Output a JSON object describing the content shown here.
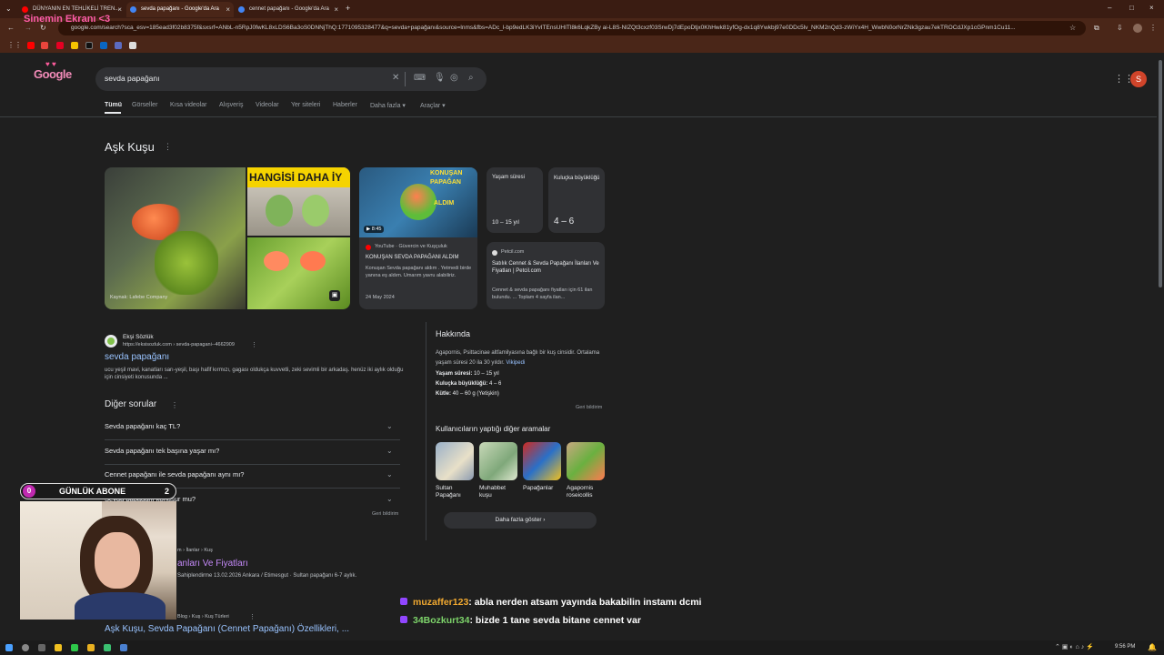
{
  "browser": {
    "tabs": [
      {
        "title": "DÜNYANIN EN TEHLİKELİ TREN...",
        "active": false
      },
      {
        "title": "sevda papağanı - Google'da Ara",
        "active": true
      },
      {
        "title": "cennet papağanı - Google'da Ara",
        "active": false
      }
    ],
    "new_tab_icon": "+",
    "url": "google.com/search?sca_esv=185ead3f02b8375f&sxsrf=ANbL-n5RpJ0fwKL8xLDS6Ba3oS0DNNjThQ:1771095328477&q=sevda+papağanı&source=lnms&fbs=ADc_l-bp9edLK3iYvITEnsUHITl8k6LqkZBy ai-L8S-NIZQt3cxzf03SrwDj7dEpoDtjx0KhHwk81yfOg-dx1q8Ywkbj97e0DDc5lv_NKM2nQd3-zWiYx4H_WwbN0orNrZNk3gzau7ekTROCdJXp1cGPnm1Cu11..."
  },
  "overlay": {
    "stream_title": "Sinemin Ekranı <3",
    "sub_counter_left": "0",
    "sub_counter_label": "GÜNLÜK ABONE",
    "sub_counter_right": "2",
    "chat": [
      {
        "user": "muzaffer123",
        "message": ": abla nerden atsam yayında bakabilin instamı dcmi",
        "color": "#f0a830"
      },
      {
        "user": "34Bozkurt34",
        "message": ": bizde 1 tane sevda bitane cennet var",
        "color": "#7dd36a"
      }
    ]
  },
  "google": {
    "logo": "Google",
    "query": "sevda papağanı",
    "nav_tabs": [
      "Tümü",
      "Görseller",
      "Kısa videolar",
      "Alışveriş",
      "Videolar",
      "Yer siteleri",
      "Haberler",
      "Daha fazla",
      "Araçlar"
    ],
    "avatar_letter": "S"
  },
  "knowledge": {
    "title": "Aşk Kuşu",
    "image_source": "Kaynak: Lafebe Company",
    "image_overlay_text": "HANGİSİ DAHA İY",
    "video": {
      "thumb_text_1": "KONUŞAN",
      "thumb_text_2": "PAPAĞAN",
      "thumb_text_3": "ALDIM",
      "duration": "▶ 8:45",
      "source": "YouTube · Güvercin ve Kuşçuluk",
      "title": "KONUŞAN SEVDA PAPAĞANI ALDIM",
      "snippet": "Konuşan Sevda papağanı aldım . Yetmedi birde yanına eş aldım. Umarım yavru alabiliriz.",
      "date": "24 May 2024"
    },
    "lifespan": {
      "label": "Yaşam süresi",
      "value": "10 – 15 yıl"
    },
    "clutch": {
      "label": "Kuluçka büyüklüğü",
      "value": "4 – 6"
    },
    "petcil": {
      "source": "Petcil.com",
      "title": "Satılık Cennet & Sevda Papağanı İlanları Ve Fiyatları | Petcil.com",
      "snippet": "Cennet & sevda papağanı fiyatları için 61 ilan bulundu. ... Toplam 4 sayfa ilan..."
    }
  },
  "result1": {
    "site": "Ekşi Sözlük",
    "url": "https://eksisozluk.com › sevda-papagani--4662909",
    "title": "sevda papağanı",
    "snippet": "ucu yeşil mavi, kanatları sarı-yeşil, başı hafif kırmızı, gagası oldukça kuvvetli, zeki sevimli bir arkadaş. henüz iki aylık olduğu için cinsiyeti konusunda ..."
  },
  "paa": {
    "title": "Diğer sorular",
    "questions": [
      "Sevda papağanı kaç TL?",
      "Sevda papağanı tek başına yaşar mı?",
      "Cennet papağanı ile sevda papağanı aynı mı?",
      "Sevda papağanı konuşur mu?"
    ],
    "feedback": "Geri bildirim"
  },
  "about": {
    "title": "Hakkında",
    "desc": "Agapornis, Psittacinae altfamilyasına bağlı bir kuş cinsidir. Ortalama yaşam süresi 20 ila 30 yıldır.",
    "wiki": "Vikipedi",
    "facts": [
      {
        "k": "Yaşam süresi:",
        "v": " 10 – 15 yıl"
      },
      {
        "k": "Kuluçka büyüklüğü:",
        "v": " 4 – 6"
      },
      {
        "k": "Kütle:",
        "v": " 40 – 60 g (Yetişkin)"
      }
    ],
    "feedback": "Geri bildirim"
  },
  "related": {
    "title": "Kullanıcıların yaptığı diğer aramalar",
    "items": [
      {
        "l1": "Sultan",
        "l2": "Papağanı"
      },
      {
        "l1": "Muhabbet",
        "l2": "kuşu"
      },
      {
        "l1": "Papağanlar",
        "l2": ""
      },
      {
        "l1": "Agapornis",
        "l2": "roseicollis"
      }
    ],
    "more": "Daha fazla göster"
  },
  "result2": {
    "breadcrumb": "m › İlanlar › Kuş",
    "title": "anları Ve Fiyatları",
    "snippet": "Sahiplendirme 13.02.2026 Ankara / Etimesgut · Sultan papağanı 6-7 aylık."
  },
  "result3": {
    "breadcrumb": "Blog › Kuş › Kuş Türleri",
    "title": "Aşk Kuşu, Sevda Papağanı (Cennet Papağanı) Özellikleri, ..."
  },
  "taskbar": {
    "time": "9:56 PM"
  }
}
